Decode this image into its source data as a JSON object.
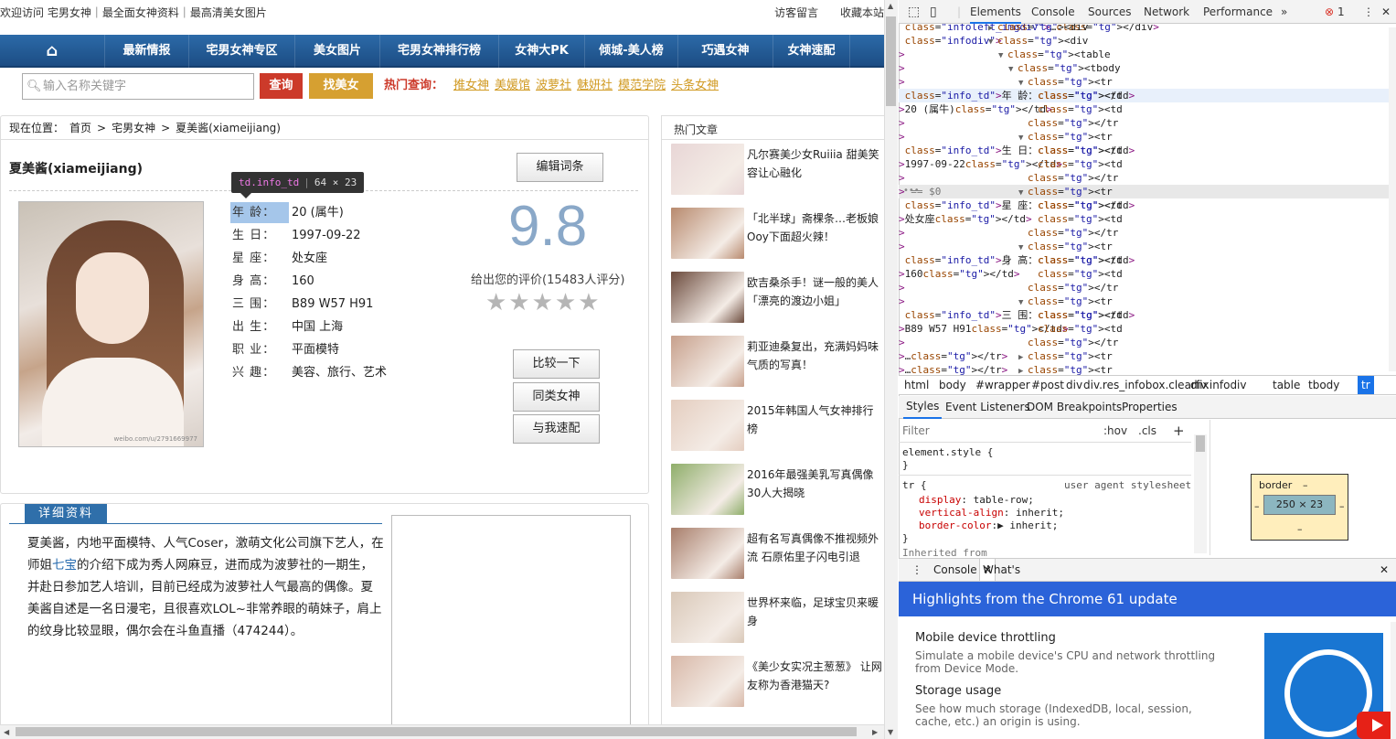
{
  "page": {
    "welcome": "欢迎访问 宅男女神｜最全面女神资料｜最高清美女图片",
    "top_links": [
      "访客留言",
      "收藏本站"
    ],
    "nav": [
      "最新情报",
      "宅男女神专区",
      "美女图片",
      "宅男女神排行榜",
      "女神大PK",
      "倾城-美人榜",
      "巧遇女神",
      "女神速配"
    ],
    "search": {
      "placeholder": "输入名称关键字",
      "query_btn": "查询",
      "find_btn": "找美女",
      "hot_label": "热门查询：",
      "hot_links": [
        "推女神",
        "美媛馆",
        "波萝社",
        "魅妍社",
        "模范学院",
        "头条女神"
      ]
    },
    "breadcrumb": [
      "现在位置：",
      "首页",
      ">",
      "宅男女神",
      ">",
      "夏美酱(xiameijiang)"
    ],
    "profile": {
      "name": "夏美酱(xiameijiang)",
      "edit_btn": "编辑词条",
      "photo_watermark": "weibo.com/u/2791669977",
      "info": [
        {
          "key": "年 龄：",
          "value": "20 (属牛)"
        },
        {
          "key": "生 日：",
          "value": "1997-09-22"
        },
        {
          "key": "星 座：",
          "value": "处女座"
        },
        {
          "key": "身 高：",
          "value": "160"
        },
        {
          "key": "三 围：",
          "value": "B89 W57 H91"
        },
        {
          "key": "出 生：",
          "value": "中国 上海"
        },
        {
          "key": "职 业：",
          "value": "平面模特"
        },
        {
          "key": "兴 趣：",
          "value": "美容、旅行、艺术"
        }
      ],
      "score": "9.8",
      "score_text": "给出您的评价(15483人评分)",
      "stars": "★★★★★",
      "compare_btn": "比较一下",
      "similar_btn": "同类女神",
      "match_btn": "与我速配"
    },
    "tooltip": {
      "tag": "td.info_td",
      "size": "64 × 23"
    },
    "detail": {
      "tab": "详细资料",
      "text_before": "夏美酱，内地平面模特、人气Coser，激萌文化公司旗下艺人，在师姐",
      "link": "七宝",
      "text_after": "的介绍下成为秀人网麻豆，进而成为波萝社的一期生，并赴日参加艺人培训，目前已经成为波萝社人气最高的偶像。夏美酱自述是一名日漫宅，且很喜欢LOL~非常养眼的萌妹子，肩上的纹身比较显眼，偶尔会在斗鱼直播（474244）。"
    },
    "hot": {
      "title": "热门文章",
      "articles": [
        {
          "text": "凡尔赛美少女Ruiiia 甜美笑容让心融化",
          "color": "#e8d6d6"
        },
        {
          "text": "「北半球」斋棵条…老板娘Ooy下面超火辣！",
          "color": "#b88a6e"
        },
        {
          "text": "欧吉桑杀手！谜一般的美人「漂亮的渡边小姐」",
          "color": "#6b4a3c"
        },
        {
          "text": "莉亚迪桑复出，充满妈妈味气质的写真！",
          "color": "#c7a08c"
        },
        {
          "text": "2015年韩国人气女神排行榜",
          "color": "#e4cdbf"
        },
        {
          "text": "2016年最强美乳写真偶像30人大揭晓",
          "color": "#8fae6a"
        },
        {
          "text": "超有名写真偶像不推视频外流 石原佑里子闪电引退",
          "color": "#a87e6b"
        },
        {
          "text": "世界杯来临，足球宝贝来暖身",
          "color": "#d9c8b8"
        },
        {
          "text": "《美少女实况主葱葱》 让网友称为香港猫天?",
          "color": "#d8b8a8"
        }
      ]
    }
  },
  "devtools": {
    "tabs": [
      "Elements",
      "Console",
      "Sources",
      "Network",
      "Performance",
      "»"
    ],
    "error_count": "1",
    "dom_lines": [
      {
        "indent": 6,
        "tri": "▶",
        "html": "<div class=\"infoleft_imgdiv\">…</div>",
        "type": "collapsed"
      },
      {
        "indent": 6,
        "tri": "▼",
        "html": "<div class=\"infodiv\">",
        "type": "open"
      },
      {
        "indent": 8,
        "tri": "▼",
        "html": "<table>",
        "type": "open"
      },
      {
        "indent": 10,
        "tri": "▼",
        "html": "<tbody>",
        "type": "open"
      },
      {
        "indent": 12,
        "tri": "▼",
        "html": "<tr>",
        "type": "open"
      },
      {
        "indent": 14,
        "tri": "",
        "html": "<td class=\"info_td\">年 龄：</td>",
        "type": "sel"
      },
      {
        "indent": 14,
        "tri": "",
        "html": "<td>20 (属牛)</td>",
        "type": "leaf"
      },
      {
        "indent": 12,
        "tri": "",
        "html": "</tr>",
        "type": "leaf"
      },
      {
        "indent": 12,
        "tri": "▼",
        "html": "<tr>",
        "type": "open"
      },
      {
        "indent": 14,
        "tri": "",
        "html": "<td class=\"info_td\">生 日：</td>",
        "type": "leaf"
      },
      {
        "indent": 14,
        "tri": "",
        "html": "<td>1997-09-22</td>",
        "type": "leaf"
      },
      {
        "indent": 12,
        "tri": "",
        "html": "</tr>",
        "type": "leaf"
      },
      {
        "indent": 12,
        "tri": "▼",
        "html": "<tr> == $0",
        "type": "hov"
      },
      {
        "indent": 14,
        "tri": "",
        "html": "<td class=\"info_td\">星 座：</td>",
        "type": "leaf"
      },
      {
        "indent": 14,
        "tri": "",
        "html": "<td>处女座</td>",
        "type": "leaf"
      },
      {
        "indent": 12,
        "tri": "",
        "html": "</tr>",
        "type": "leaf"
      },
      {
        "indent": 12,
        "tri": "▼",
        "html": "<tr>",
        "type": "open"
      },
      {
        "indent": 14,
        "tri": "",
        "html": "<td class=\"info_td\">身 高：</td>",
        "type": "leaf"
      },
      {
        "indent": 14,
        "tri": "",
        "html": "<td>160</td>",
        "type": "leaf"
      },
      {
        "indent": 12,
        "tri": "",
        "html": "</tr>",
        "type": "leaf"
      },
      {
        "indent": 12,
        "tri": "▼",
        "html": "<tr>",
        "type": "open"
      },
      {
        "indent": 14,
        "tri": "",
        "html": "<td class=\"info_td\">三 围：</td>",
        "type": "leaf"
      },
      {
        "indent": 14,
        "tri": "",
        "html": "<td>B89 W57 H91</td>",
        "type": "leaf"
      },
      {
        "indent": 12,
        "tri": "",
        "html": "</tr>",
        "type": "leaf"
      },
      {
        "indent": 12,
        "tri": "▶",
        "html": "<tr>…</tr>",
        "type": "collapsed"
      },
      {
        "indent": 12,
        "tri": "▶",
        "html": "<tr>…</tr>",
        "type": "collapsed"
      }
    ],
    "crumbs": [
      "html",
      "body",
      "#wrapper",
      "#post",
      "div",
      "div.res_infobox.clearfix",
      "div.infodiv",
      "table",
      "tbody",
      "tr"
    ],
    "style_tabs": [
      "Styles",
      "Event Listeners",
      "DOM Breakpoints",
      "Properties"
    ],
    "filter": {
      "placeholder": "Filter",
      "hov": ":hov",
      "cls": ".cls",
      "plus": "+"
    },
    "styles": {
      "element_style": "element.style {",
      "close": "}",
      "tr_rule": "tr {",
      "tr_source": "user agent stylesheet",
      "props": [
        [
          "display",
          "table-row"
        ],
        [
          "vertical-align",
          "inherit"
        ],
        [
          "border-color",
          "inherit"
        ]
      ],
      "inherited": "Inherited from"
    },
    "box_model": {
      "label": "border",
      "dash": "–",
      "size": "250 × 23"
    },
    "drawer_tabs": [
      "Console",
      "What's New"
    ],
    "whats_new": {
      "header": "Highlights from the Chrome 61 update",
      "items": [
        {
          "title": "Mobile device throttling",
          "desc": "Simulate a mobile device's CPU and network throttling from Device Mode."
        },
        {
          "title": "Storage usage",
          "desc": "See how much storage (IndexedDB, local, session, cache, etc.) an origin is using."
        }
      ]
    }
  }
}
